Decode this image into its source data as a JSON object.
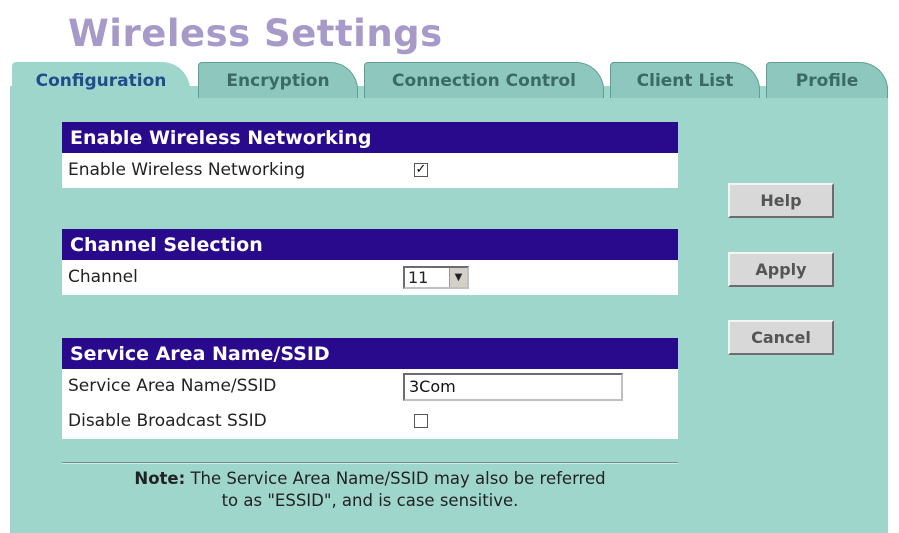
{
  "page": {
    "title": "Wireless Settings"
  },
  "tabs": [
    {
      "label": "Configuration",
      "active": true
    },
    {
      "label": "Encryption",
      "active": false
    },
    {
      "label": "Connection Control",
      "active": false
    },
    {
      "label": "Client List",
      "active": false
    },
    {
      "label": "Profile",
      "active": false
    }
  ],
  "sections": {
    "wireless": {
      "header": "Enable Wireless Networking",
      "label": "Enable Wireless Networking",
      "checked": true,
      "check_mark": "✓"
    },
    "channel": {
      "header": "Channel Selection",
      "label": "Channel",
      "value": "11",
      "arrow": "▼"
    },
    "ssid": {
      "header": "Service Area Name/SSID",
      "ssid_label": "Service Area Name/SSID",
      "ssid_value": "3Com",
      "broadcast_label": "Disable Broadcast SSID",
      "broadcast_checked": false
    }
  },
  "buttons": {
    "help": "Help",
    "apply": "Apply",
    "cancel": "Cancel"
  },
  "note": {
    "prefix": "Note:",
    "line1": " The Service Area Name/SSID may also be referred",
    "line2": "to as \"ESSID\", and is case sensitive."
  },
  "colors": {
    "title": "#a89ac8",
    "band": "#9fd6cc",
    "header": "#2a0a8c",
    "active_tab_text": "#1f4c8a"
  }
}
